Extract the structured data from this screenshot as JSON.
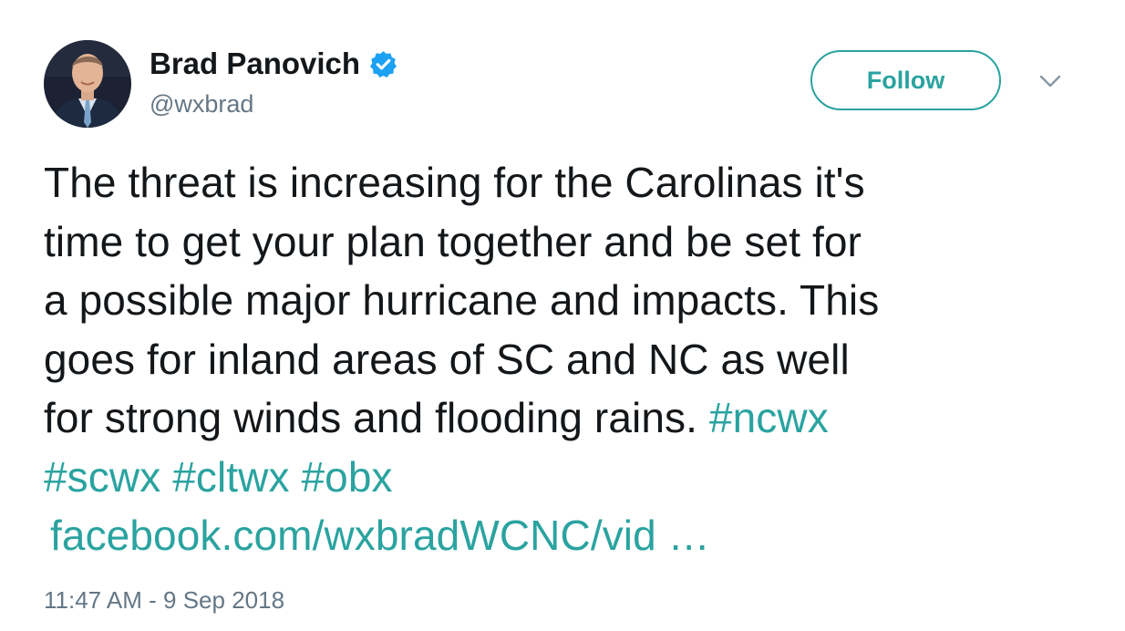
{
  "user": {
    "display_name": "Brad Panovich",
    "handle": "@wxbrad",
    "verified": true,
    "avatar_icon": "profile-photo"
  },
  "actions": {
    "follow_label": "Follow",
    "menu_icon": "chevron-down-icon"
  },
  "tweet": {
    "lines": [
      "The threat is increasing for the Carolinas it's",
      "time to get your plan together and be set for",
      "a possible major hurricane and impacts. This",
      "goes for inland areas of SC and NC as well",
      "for strong winds and flooding rains."
    ],
    "hashtags": [
      "#ncwx",
      "#scwx",
      "#cltwx",
      "#obx"
    ],
    "link": "facebook.com/wxbradWCNC/vid …"
  },
  "timestamp": "11:47 AM - 9 Sep 2018",
  "colors": {
    "accent": "#2aa3a0",
    "text": "#14171a",
    "secondary": "#657786",
    "verified": "#1da1f2"
  }
}
